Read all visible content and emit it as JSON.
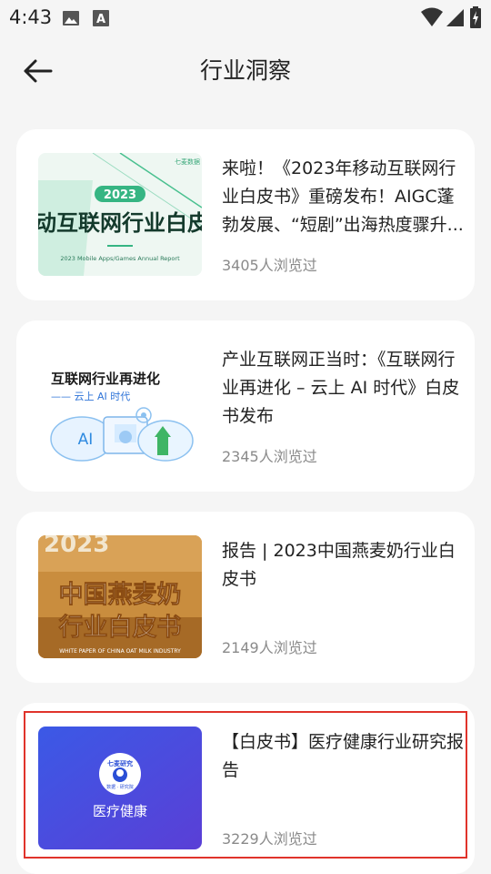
{
  "status_bar": {
    "time": "4:43",
    "icons": [
      "image-icon",
      "a-badge-icon",
      "wifi-icon",
      "signal-icon",
      "battery-charging-icon"
    ]
  },
  "header": {
    "back_icon": "arrow-left-icon",
    "title": "行业洞察"
  },
  "articles": [
    {
      "title": "来啦！《2023年移动互联网行业白皮书》重磅发布！AIGC蓬勃发展、“短剧”出海热度骤升...",
      "views": "3405人浏览过",
      "thumb": {
        "corner": "七麦数据",
        "year": "2023",
        "headline": "动互联网行业白皮",
        "subtitle": "2023 Mobile Apps/Games Annual Report"
      }
    },
    {
      "title": "产业互联网正当时：《互联网行业再进化 – 云上 AI 时代》白皮书发布",
      "views": "2345人浏览过",
      "thumb": {
        "headline": "互联网行业再进化",
        "subtitle": "—— 云上 AI 时代",
        "ai_label": "AI"
      }
    },
    {
      "title": "报告 | 2023中国燕麦奶行业白皮书",
      "views": "2149人浏览过",
      "thumb": {
        "year": "2023",
        "line1": "中国燕麦奶",
        "line2": "行业白皮书",
        "subtitle": "WHITE PAPER OF CHINA OAT MILK INDUSTRY"
      }
    },
    {
      "title": "【白皮书】医疗健康行业研究报告",
      "views": "3229人浏览过",
      "thumb": {
        "badge_top": "七麦研究",
        "badge_bottom": "数据 · 研究院",
        "label": "医疗健康"
      }
    }
  ],
  "colors": {
    "selection_border": "#e0332b",
    "background": "#f5f5f5",
    "views_text": "#8a8a8a"
  }
}
